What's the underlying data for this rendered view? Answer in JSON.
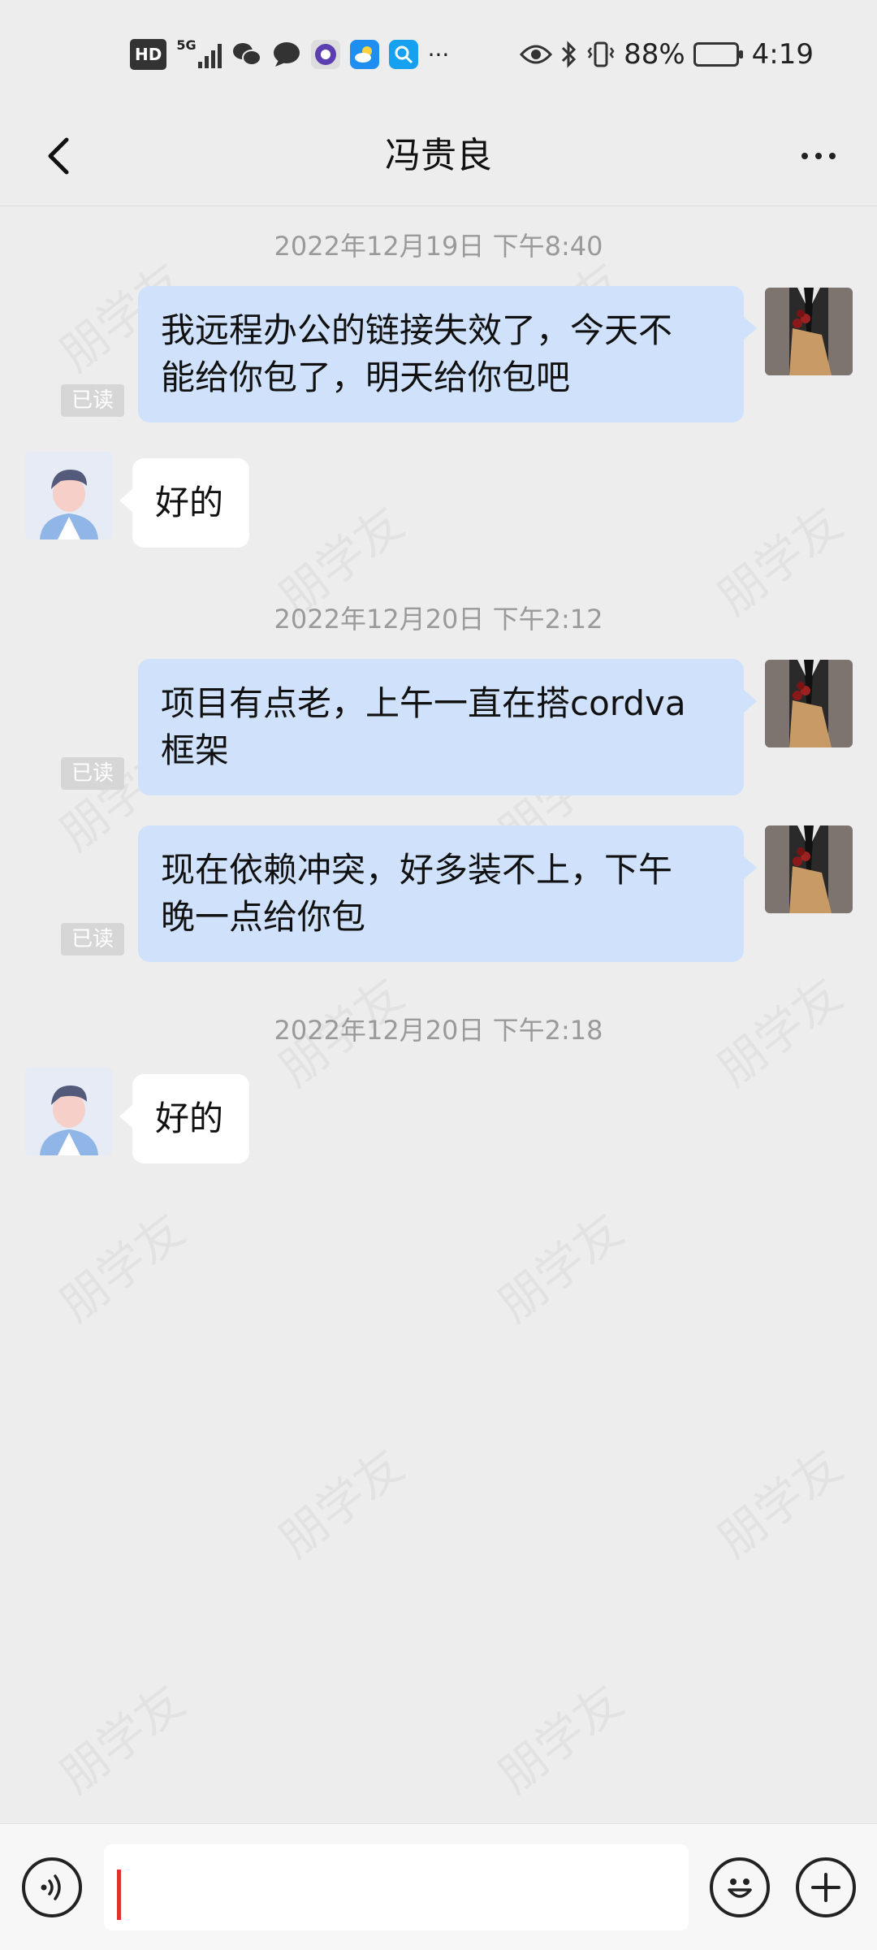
{
  "status_bar": {
    "hd_label": "HD",
    "network_label": "5G",
    "battery_percent_text": "88%",
    "battery_level": 0.88,
    "time": "4:19",
    "more_notifications": "···",
    "icons": [
      "hd-icon",
      "signal-icon",
      "wechat-icon",
      "message-icon",
      "app-icon",
      "weather-icon",
      "search-app-icon",
      "eye-icon",
      "bluetooth-icon",
      "vibrate-icon",
      "battery-icon"
    ]
  },
  "header": {
    "title": "冯贵良",
    "back_icon": "chevron-left-icon",
    "more_icon": "more-horizontal-icon"
  },
  "messages": [
    {
      "type": "time",
      "text": "2022年12月19日 下午8:40"
    },
    {
      "type": "out",
      "lines": [
        "我远程办公的链接失效了，今天不",
        "能给你包了，明天给你包吧"
      ],
      "read_label": "已读"
    },
    {
      "type": "in",
      "text": "好的"
    },
    {
      "type": "time",
      "text": "2022年12月20日 下午2:12"
    },
    {
      "type": "out",
      "lines": [
        "项目有点老，上午一直在搭cordva",
        "框架"
      ],
      "read_label": "已读"
    },
    {
      "type": "out",
      "lines": [
        "现在依赖冲突，好多装不上，下午",
        "晚一点给你包"
      ],
      "read_label": "已读"
    },
    {
      "type": "time",
      "text": "2022年12月20日 下午2:18"
    },
    {
      "type": "in",
      "text": "好的"
    }
  ],
  "watermark_text": "朋学友",
  "input_bar": {
    "voice_icon": "voice-icon",
    "emoji_icon": "emoji-icon",
    "plus_icon": "plus-icon",
    "value": ""
  }
}
